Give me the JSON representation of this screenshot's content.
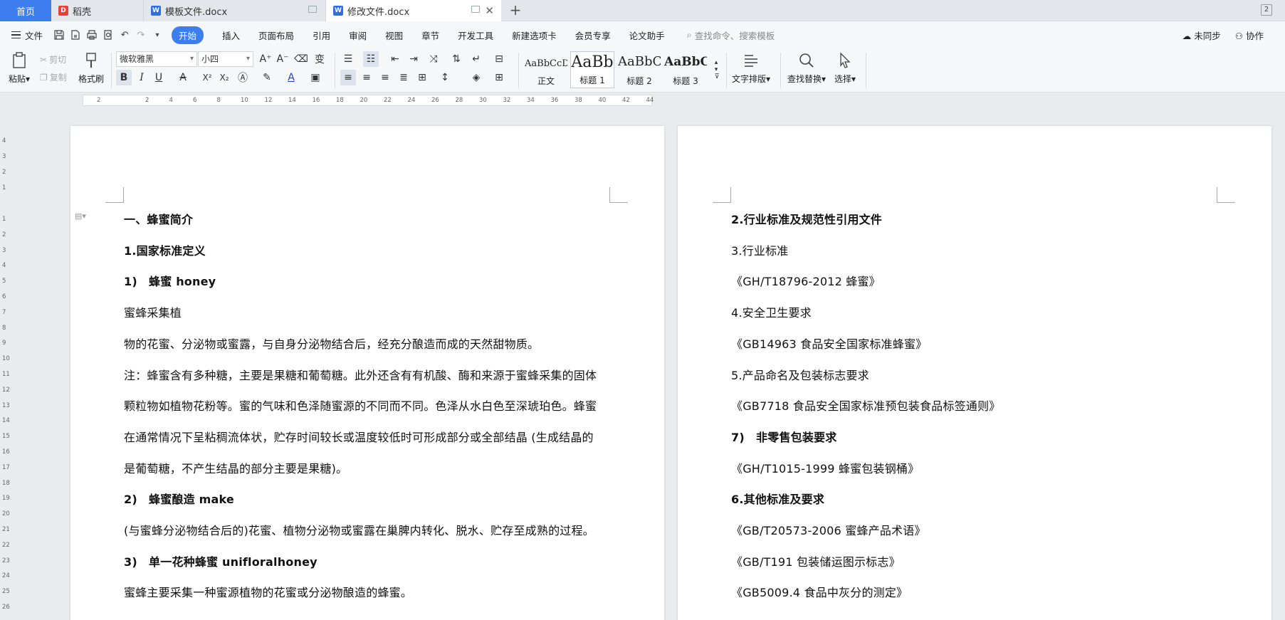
{
  "tabs": {
    "home": "首页",
    "daoke": "稻壳",
    "template": "模板文件.docx",
    "modified": "修改文件.docx",
    "right_badge": "2"
  },
  "menu": {
    "file": "文件",
    "items": [
      "开始",
      "插入",
      "页面布局",
      "引用",
      "审阅",
      "视图",
      "章节",
      "开发工具",
      "新建选项卡",
      "会员专享",
      "论文助手"
    ],
    "search_placeholder": "查找命令、搜索模板",
    "sync": "未同步",
    "collab": "协作"
  },
  "ribbon": {
    "paste": "粘贴",
    "cut": "剪切",
    "copy": "复制",
    "format_painter": "格式刷",
    "font": "微软雅黑",
    "size": "小四",
    "styles": [
      {
        "preview": "AaBbCcDd",
        "label": "正文"
      },
      {
        "preview": "AaBb",
        "label": "标题 1"
      },
      {
        "preview": "AaBbC",
        "label": "标题 2"
      },
      {
        "preview": "AaBbCc",
        "label": "标题 3"
      }
    ],
    "text_layout": "文字排版",
    "find_replace": "查找替换",
    "select": "选择"
  },
  "ruler_h": [
    "2",
    "2",
    "4",
    "6",
    "8",
    "10",
    "12",
    "14",
    "16",
    "18",
    "20",
    "22",
    "24",
    "26",
    "28",
    "30",
    "32",
    "34",
    "36",
    "38",
    "40",
    "42",
    "44"
  ],
  "ruler_v": [
    "4",
    "3",
    "2",
    "1",
    "1",
    "2",
    "3",
    "4",
    "5",
    "6",
    "7",
    "8",
    "9",
    "10",
    "11",
    "12",
    "13",
    "14",
    "15",
    "16",
    "17",
    "18",
    "19",
    "20",
    "21",
    "22",
    "23",
    "24",
    "25",
    "26"
  ],
  "left_page": [
    {
      "text": "一、蜂蜜简介",
      "bold": true
    },
    {
      "text": "1.国家标准定义",
      "bold": true
    },
    {
      "text": "1)　蜂蜜 honey",
      "bold": true
    },
    {
      "text": "蜜蜂采集植",
      "bold": false
    },
    {
      "text": "物的花蜜、分泌物或蜜露，与自身分泌物结合后，经充分酿造而成的天然甜物质。",
      "bold": false
    },
    {
      "text": "注：蜂蜜含有多种糖，主要是果糖和葡萄糖。此外还含有有机酸、酶和来源于蜜蜂采集的固体",
      "bold": false
    },
    {
      "text": "颗粒物如植物花粉等。蜜的气味和色泽随蜜源的不同而不同。色泽从水白色至深琥珀色。蜂蜜",
      "bold": false
    },
    {
      "text": "在通常情况下呈粘稠流体状，贮存时间较长或温度较低时可形成部分或全部结晶 (生成结晶的",
      "bold": false
    },
    {
      "text": "是葡萄糖，不产生结晶的部分主要是果糖)。",
      "bold": false
    },
    {
      "text": "2)　蜂蜜酿造 make",
      "bold": true
    },
    {
      "text": "(与蜜蜂分泌物结合后的)花蜜、植物分泌物或蜜露在巢脾内转化、脱水、贮存至成熟的过程。",
      "bold": false
    },
    {
      "text": "3)　单一花种蜂蜜 unifloralhoney",
      "bold": true
    },
    {
      "text": "蜜蜂主要采集一种蜜源植物的花蜜或分泌物酿造的蜂蜜。",
      "bold": false
    }
  ],
  "right_page": [
    {
      "text": "2.行业标准及规范性引用文件",
      "bold": true
    },
    {
      "text": "3.行业标准",
      "bold": false
    },
    {
      "text": "《GH/T18796-2012 蜂蜜》",
      "bold": false
    },
    {
      "text": "4.安全卫生要求",
      "bold": false
    },
    {
      "text": "《GB14963 食品安全国家标准蜂蜜》",
      "bold": false
    },
    {
      "text": "5.产品命名及包装标志要求",
      "bold": false
    },
    {
      "text": "《GB7718 食品安全国家标准预包装食品标签通则》",
      "bold": false
    },
    {
      "text": "7)　非零售包装要求",
      "bold": true
    },
    {
      "text": "《GH/T1015-1999 蜂蜜包装钢桶》",
      "bold": false
    },
    {
      "text": "6.其他标准及要求",
      "bold": true
    },
    {
      "text": "《GB/T20573-2006 蜜蜂产品术语》",
      "bold": false
    },
    {
      "text": "《GB/T191 包装储运图示标志》",
      "bold": false
    },
    {
      "text": "《GB5009.4 食品中灰分的测定》",
      "bold": false
    }
  ]
}
